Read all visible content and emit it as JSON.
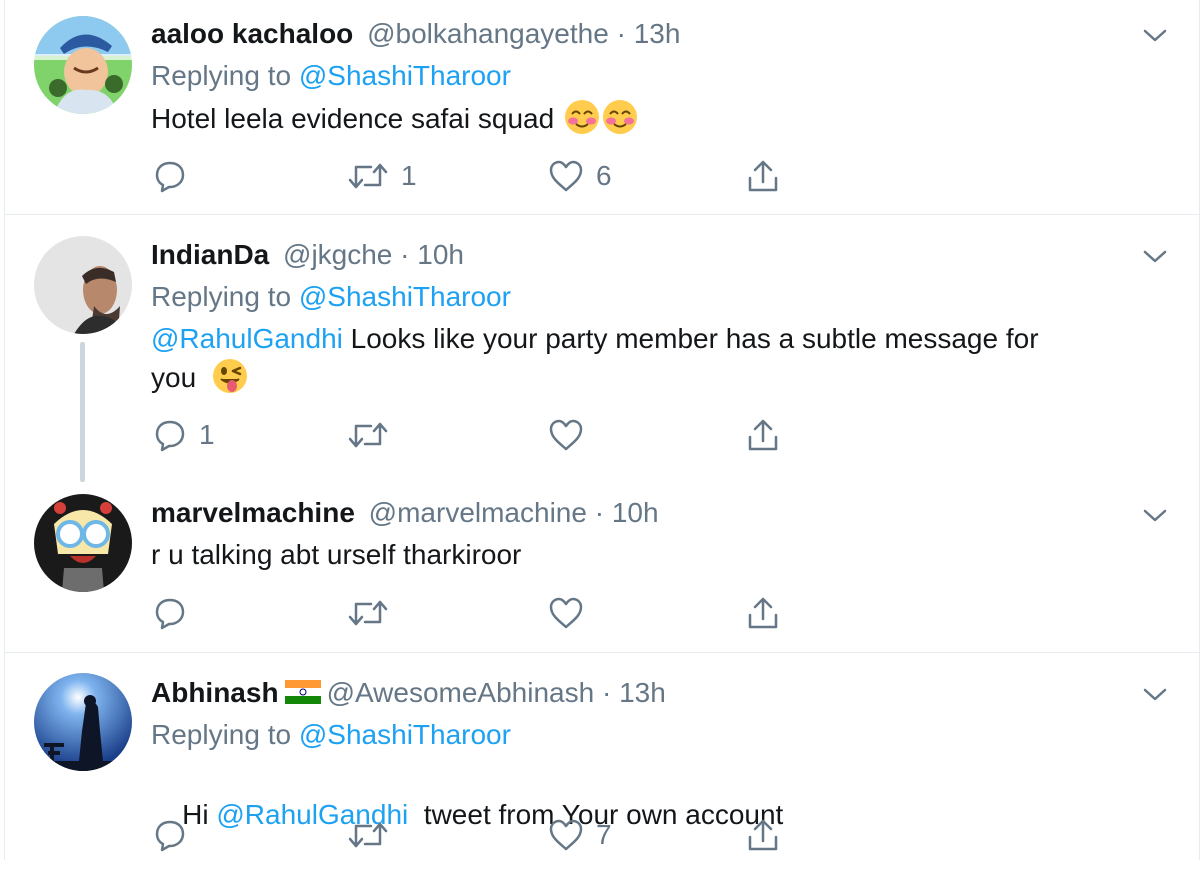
{
  "tweets": [
    {
      "name": "aaloo kachaloo",
      "handle": "@bolkahangayethe",
      "time": "13h",
      "replying_prefix": "Replying to ",
      "replying_to": "@ShashiTharoor",
      "text": "Hotel leela evidence safai squad",
      "emoji": "smiling-blush-emoji x2",
      "reply_count": "",
      "retweet_count": "1",
      "like_count": "6"
    },
    {
      "name": "IndianDa",
      "handle": "@jkgche",
      "time": "10h",
      "replying_prefix": "Replying to ",
      "replying_to": "@ShashiTharoor",
      "mention": "@RahulGandhi",
      "text_line1": " Looks like your party member has a subtle message for",
      "text_line2": "you",
      "emoji": "winking-tongue-emoji",
      "reply_count": "1",
      "retweet_count": "",
      "like_count": ""
    },
    {
      "name": "marvelmachine",
      "handle": "@marvelmachine",
      "time": "10h",
      "text": "r u talking abt urself tharkiroor",
      "reply_count": "",
      "retweet_count": "",
      "like_count": ""
    },
    {
      "name": "Abhinash",
      "flag": "india-flag-icon",
      "handle": "@AwesomeAbhinash",
      "time": "13h",
      "replying_prefix": "Replying to ",
      "replying_to": "@ShashiTharoor",
      "text_prefix": "Hi ",
      "mention": "@RahulGandhi",
      "text_suffix": "  tweet from Your own account",
      "reply_count": "",
      "retweet_count": "",
      "like_count": "7"
    }
  ],
  "separator": " · ",
  "colors": {
    "link": "#1da1f2",
    "muted": "#657786",
    "text": "#14171a",
    "divider": "#e6ecf0",
    "thread_line": "#ccd6dd"
  }
}
